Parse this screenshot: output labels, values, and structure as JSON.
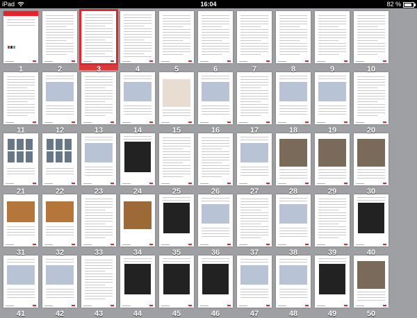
{
  "status_bar": {
    "device": "iPad",
    "time": "16:04",
    "battery_percent": "82 %",
    "battery_level": 0.82,
    "icons": [
      "wifi-icon",
      "battery-icon"
    ]
  },
  "colors": {
    "background": "#9ea0a3",
    "selection": "#d93a3a",
    "accent_red": "#e0262d"
  },
  "thumbnails": {
    "selected_page": "3",
    "pages": [
      "1",
      "2",
      "3",
      "4",
      "5",
      "6",
      "7",
      "8",
      "9",
      "10",
      "11",
      "12",
      "13",
      "14",
      "15",
      "16",
      "17",
      "18",
      "19",
      "20",
      "21",
      "22",
      "23",
      "24",
      "25",
      "26",
      "27",
      "28",
      "29",
      "30",
      "31",
      "32",
      "33",
      "34",
      "35",
      "36",
      "37",
      "38",
      "39",
      "40",
      "41",
      "42",
      "43",
      "44",
      "45",
      "46",
      "47",
      "48",
      "49",
      "50"
    ]
  }
}
